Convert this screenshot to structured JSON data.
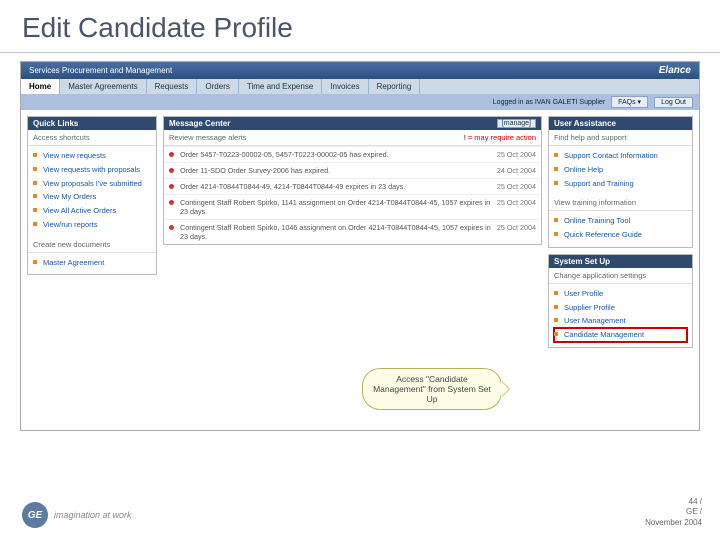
{
  "slide": {
    "title": "Edit Candidate Profile"
  },
  "header": {
    "app_title": "Services Procurement and Management",
    "logo": "Elance"
  },
  "tabs": [
    "Home",
    "Master Agreements",
    "Requests",
    "Orders",
    "Time and Expense",
    "Invoices",
    "Reporting"
  ],
  "subbar": {
    "logged_in": "Logged in as IVAN GALETI Supplier",
    "faq_label": "FAQs ▾",
    "logout_label": "Log Out"
  },
  "quick_links": {
    "title": "Quick Links",
    "subtitle": "Access shortcuts",
    "items": [
      "View new requests",
      "View requests with proposals",
      "View proposals I've submitted",
      "View My Orders",
      "View All Active Orders",
      "View/run reports"
    ],
    "section2_subtitle": "Create new documents",
    "section2_items": [
      "Master Agreement"
    ]
  },
  "message_center": {
    "title": "Message Center",
    "manage_label": "[manage]",
    "subtitle": "Review message alerts",
    "required_note": "! = may require action",
    "messages": [
      {
        "text": "Order 5457-T0223-00002-05, 5457-T0223-00002-05 has expired.",
        "date": "25 Oct 2004"
      },
      {
        "text": "Order 11-SDO Order Survey-2006 has expired.",
        "date": "24 Oct 2004"
      },
      {
        "text": "Order 4214-T0844T0844-49, 4214-T0844T0844-49 expires in 23 days.",
        "date": "25 Oct 2004"
      },
      {
        "text": "Contingent Staff Robert Spirko, 1141 assignment on Order 4214-T0844T0844-45, 1057 expires in 23 days.",
        "date": "25 Oct 2004"
      },
      {
        "text": "Contingent Staff Robert Spirko, 1046 assignment on Order 4214-T0844T0844-45, 1057 expires in 23 days.",
        "date": "25 Oct 2004"
      }
    ]
  },
  "user_assistance": {
    "title": "User Assistance",
    "subtitle": "Find help and support",
    "items": [
      "Support Contact Information",
      "Online Help",
      "Support and Training"
    ],
    "section2_subtitle": "View training information",
    "section2_items": [
      "Online Training Tool",
      "Quick Reference Guide"
    ]
  },
  "system_setup": {
    "title": "System Set Up",
    "subtitle": "Change application settings",
    "items": [
      "User Profile",
      "Supplier Profile",
      "User Management",
      "Candidate Management"
    ]
  },
  "callout": {
    "text": "Access \"Candidate Management\" from System Set Up"
  },
  "footer": {
    "logo_text": "GE",
    "tagline": "imagination at work",
    "line1": "44 /",
    "line2": "GE /",
    "line3": "November 2004"
  }
}
